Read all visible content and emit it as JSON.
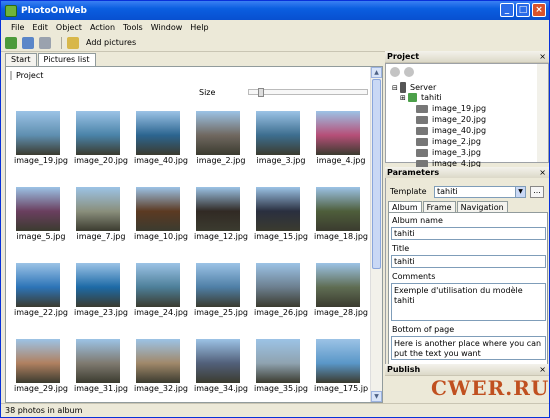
{
  "window": {
    "title": "PhotoOnWeb"
  },
  "menu": [
    "File",
    "Edit",
    "Object",
    "Action",
    "Tools",
    "Window",
    "Help"
  ],
  "toolbar": {
    "add_pictures": "Add pictures"
  },
  "tabs": [
    "Start",
    "Pictures list"
  ],
  "panel": {
    "project_label": "Project",
    "size_label": "Size"
  },
  "slider": {
    "value": 0.08
  },
  "photos": [
    {
      "name": "image_19.jpg",
      "color": "#5f8fb0"
    },
    {
      "name": "image_20.jpg",
      "color": "#4a83a8"
    },
    {
      "name": "image_40.jpg",
      "color": "#2c6590"
    },
    {
      "name": "image_2.jpg",
      "color": "#706860"
    },
    {
      "name": "image_3.jpg",
      "color": "#3d6e8f"
    },
    {
      "name": "image_4.jpg",
      "color": "#b64f78"
    },
    {
      "name": "image_5.jpg",
      "color": "#6a3f5f"
    },
    {
      "name": "image_7.jpg",
      "color": "#8a8f7c"
    },
    {
      "name": "image_10.jpg",
      "color": "#5c3a22"
    },
    {
      "name": "image_12.jpg",
      "color": "#312a24"
    },
    {
      "name": "image_15.jpg",
      "color": "#2a2f3f"
    },
    {
      "name": "image_18.jpg",
      "color": "#4e5e3b"
    },
    {
      "name": "image_22.jpg",
      "color": "#2d74b7"
    },
    {
      "name": "image_23.jpg",
      "color": "#1d6aa6"
    },
    {
      "name": "image_24.jpg",
      "color": "#4d7f99"
    },
    {
      "name": "image_25.jpg",
      "color": "#4f7fa6"
    },
    {
      "name": "image_26.jpg",
      "color": "#6c7f8f"
    },
    {
      "name": "image_28.jpg",
      "color": "#5f6d53"
    },
    {
      "name": "image_29.jpg",
      "color": "#b08060"
    },
    {
      "name": "image_31.jpg",
      "color": "#7f7a70"
    },
    {
      "name": "image_32.jpg",
      "color": "#a0886a"
    },
    {
      "name": "image_34.jpg",
      "color": "#52607a"
    },
    {
      "name": "image_35.jpg",
      "color": "#8fa3b0"
    },
    {
      "name": "image_175.jp",
      "color": "#5a97c8"
    }
  ],
  "status": "38 photos in album",
  "project": {
    "title": "Project",
    "tree": [
      "Server",
      "tahiti",
      "image_19.jpg",
      "image_20.jpg",
      "image_40.jpg",
      "image_2.jpg",
      "image_3.jpg",
      "image_4.jpg"
    ]
  },
  "parameters": {
    "title": "Parameters",
    "template_label": "Template",
    "template_value": "tahiti",
    "dots": "...",
    "tabs": [
      "Album",
      "Frame",
      "Navigation"
    ],
    "album_name_label": "Album name",
    "album_name": "tahiti",
    "title_label": "Title",
    "title_value": "tahiti",
    "comments_label": "Comments",
    "comments": "Exemple d'utilisation du modèle tahiti",
    "bottom_label": "Bottom of page",
    "bottom": "Here is another place where you can put the text you want"
  },
  "publish": {
    "title": "Publish"
  },
  "watermark": "CWER.RU"
}
